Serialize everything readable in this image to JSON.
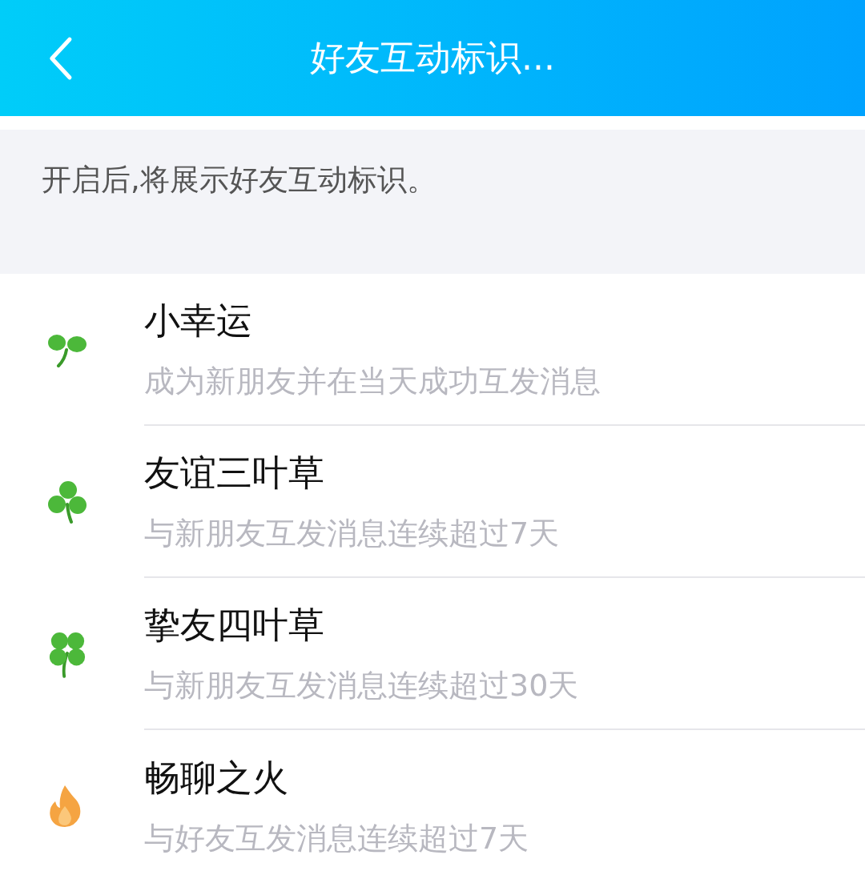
{
  "header": {
    "title": "好友互动标识..."
  },
  "notice": "开启后,将展示好友互动标识。",
  "items": [
    {
      "kind": "sprout",
      "title": "小幸运",
      "description": "成为新朋友并在当天成功互发消息"
    },
    {
      "kind": "clover3",
      "title": "友谊三叶草",
      "description": "与新朋友互发消息连续超过7天"
    },
    {
      "kind": "clover4",
      "title": "挚友四叶草",
      "description": "与新朋友互发消息连续超过30天"
    },
    {
      "kind": "flame",
      "title": "畅聊之火",
      "description": "与好友互发消息连续超过7天"
    }
  ]
}
